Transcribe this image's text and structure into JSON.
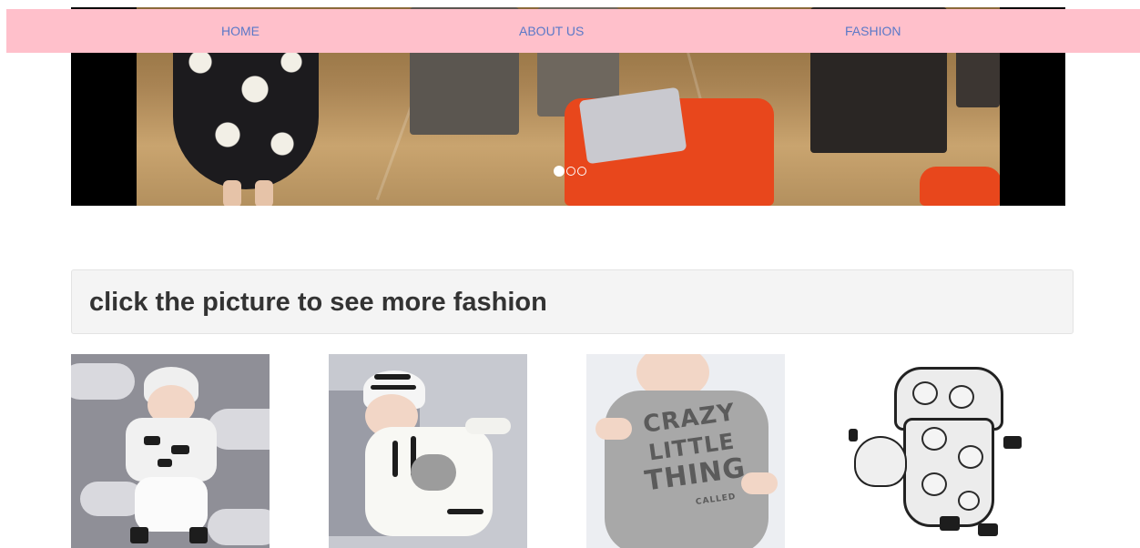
{
  "nav": {
    "items": [
      {
        "label": "HOME"
      },
      {
        "label": "ABOUT US"
      },
      {
        "label": "FASHION"
      }
    ],
    "background": "#ffc0cb",
    "link_color": "#5a78c8"
  },
  "carousel": {
    "slide_count": 3,
    "active_index": 0
  },
  "section": {
    "heading": "click the picture to see more fashion"
  },
  "gallery": {
    "items": [
      {
        "icon": "baby-cloud-outfit-image"
      },
      {
        "icon": "baby-zebra-romper-image"
      },
      {
        "icon": "baby-crazy-little-thing-tee-image",
        "print_line1": "CRAZY",
        "print_line2": "LITTLE",
        "print_line3": "THING",
        "print_line4": "CALLED"
      },
      {
        "icon": "baby-panda-romper-image"
      }
    ]
  }
}
